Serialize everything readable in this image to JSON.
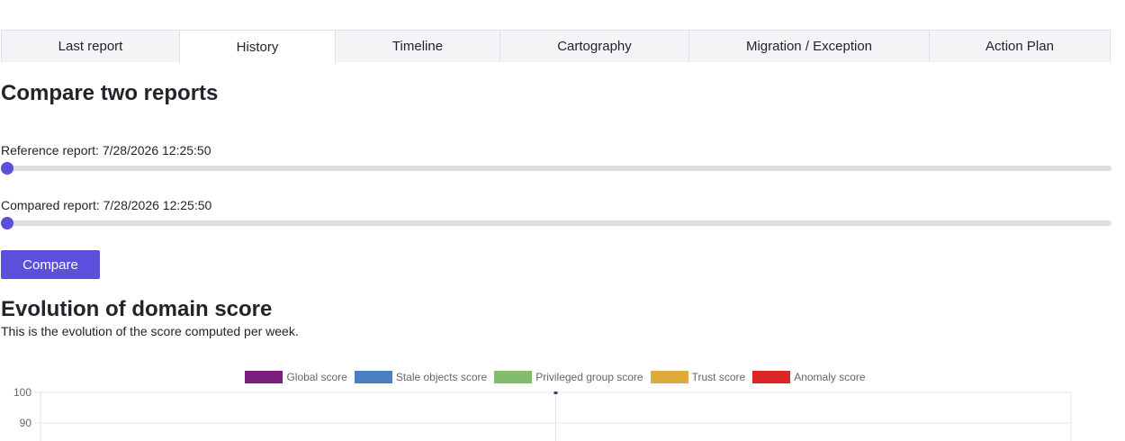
{
  "tabs": [
    {
      "label": "Last report",
      "active": false
    },
    {
      "label": "History",
      "active": true
    },
    {
      "label": "Timeline",
      "active": false
    },
    {
      "label": "Cartography",
      "active": false
    },
    {
      "label": "Migration / Exception",
      "active": false
    },
    {
      "label": "Action Plan",
      "active": false
    }
  ],
  "compare": {
    "title": "Compare two reports",
    "reference_label": "Reference report: 7/28/2026 12:25:50",
    "compared_label": "Compared report: 7/28/2026 12:25:50",
    "reference_slider_value": 0,
    "compared_slider_value": 0,
    "button_label": "Compare"
  },
  "evolution": {
    "title": "Evolution of domain score",
    "description": "This is the evolution of the score computed per week."
  },
  "colors": {
    "accent": "#5b4fdc",
    "tab_bg": "#f3f4f6",
    "track": "#dde0e3"
  },
  "chart_data": {
    "type": "line",
    "series": [
      {
        "name": "Global score",
        "color": "#7b1f7f",
        "values": [
          100
        ]
      },
      {
        "name": "Stale objects score",
        "color": "#4a7fc1",
        "values": []
      },
      {
        "name": "Privileged group score",
        "color": "#82bd6c",
        "values": []
      },
      {
        "name": "Trust score",
        "color": "#deac3c",
        "values": []
      },
      {
        "name": "Anomaly score",
        "color": "#dc2626",
        "values": []
      }
    ],
    "y_ticks": [
      100,
      90
    ],
    "ylim": [
      0,
      100
    ],
    "grid": true,
    "legend": "top-center"
  }
}
